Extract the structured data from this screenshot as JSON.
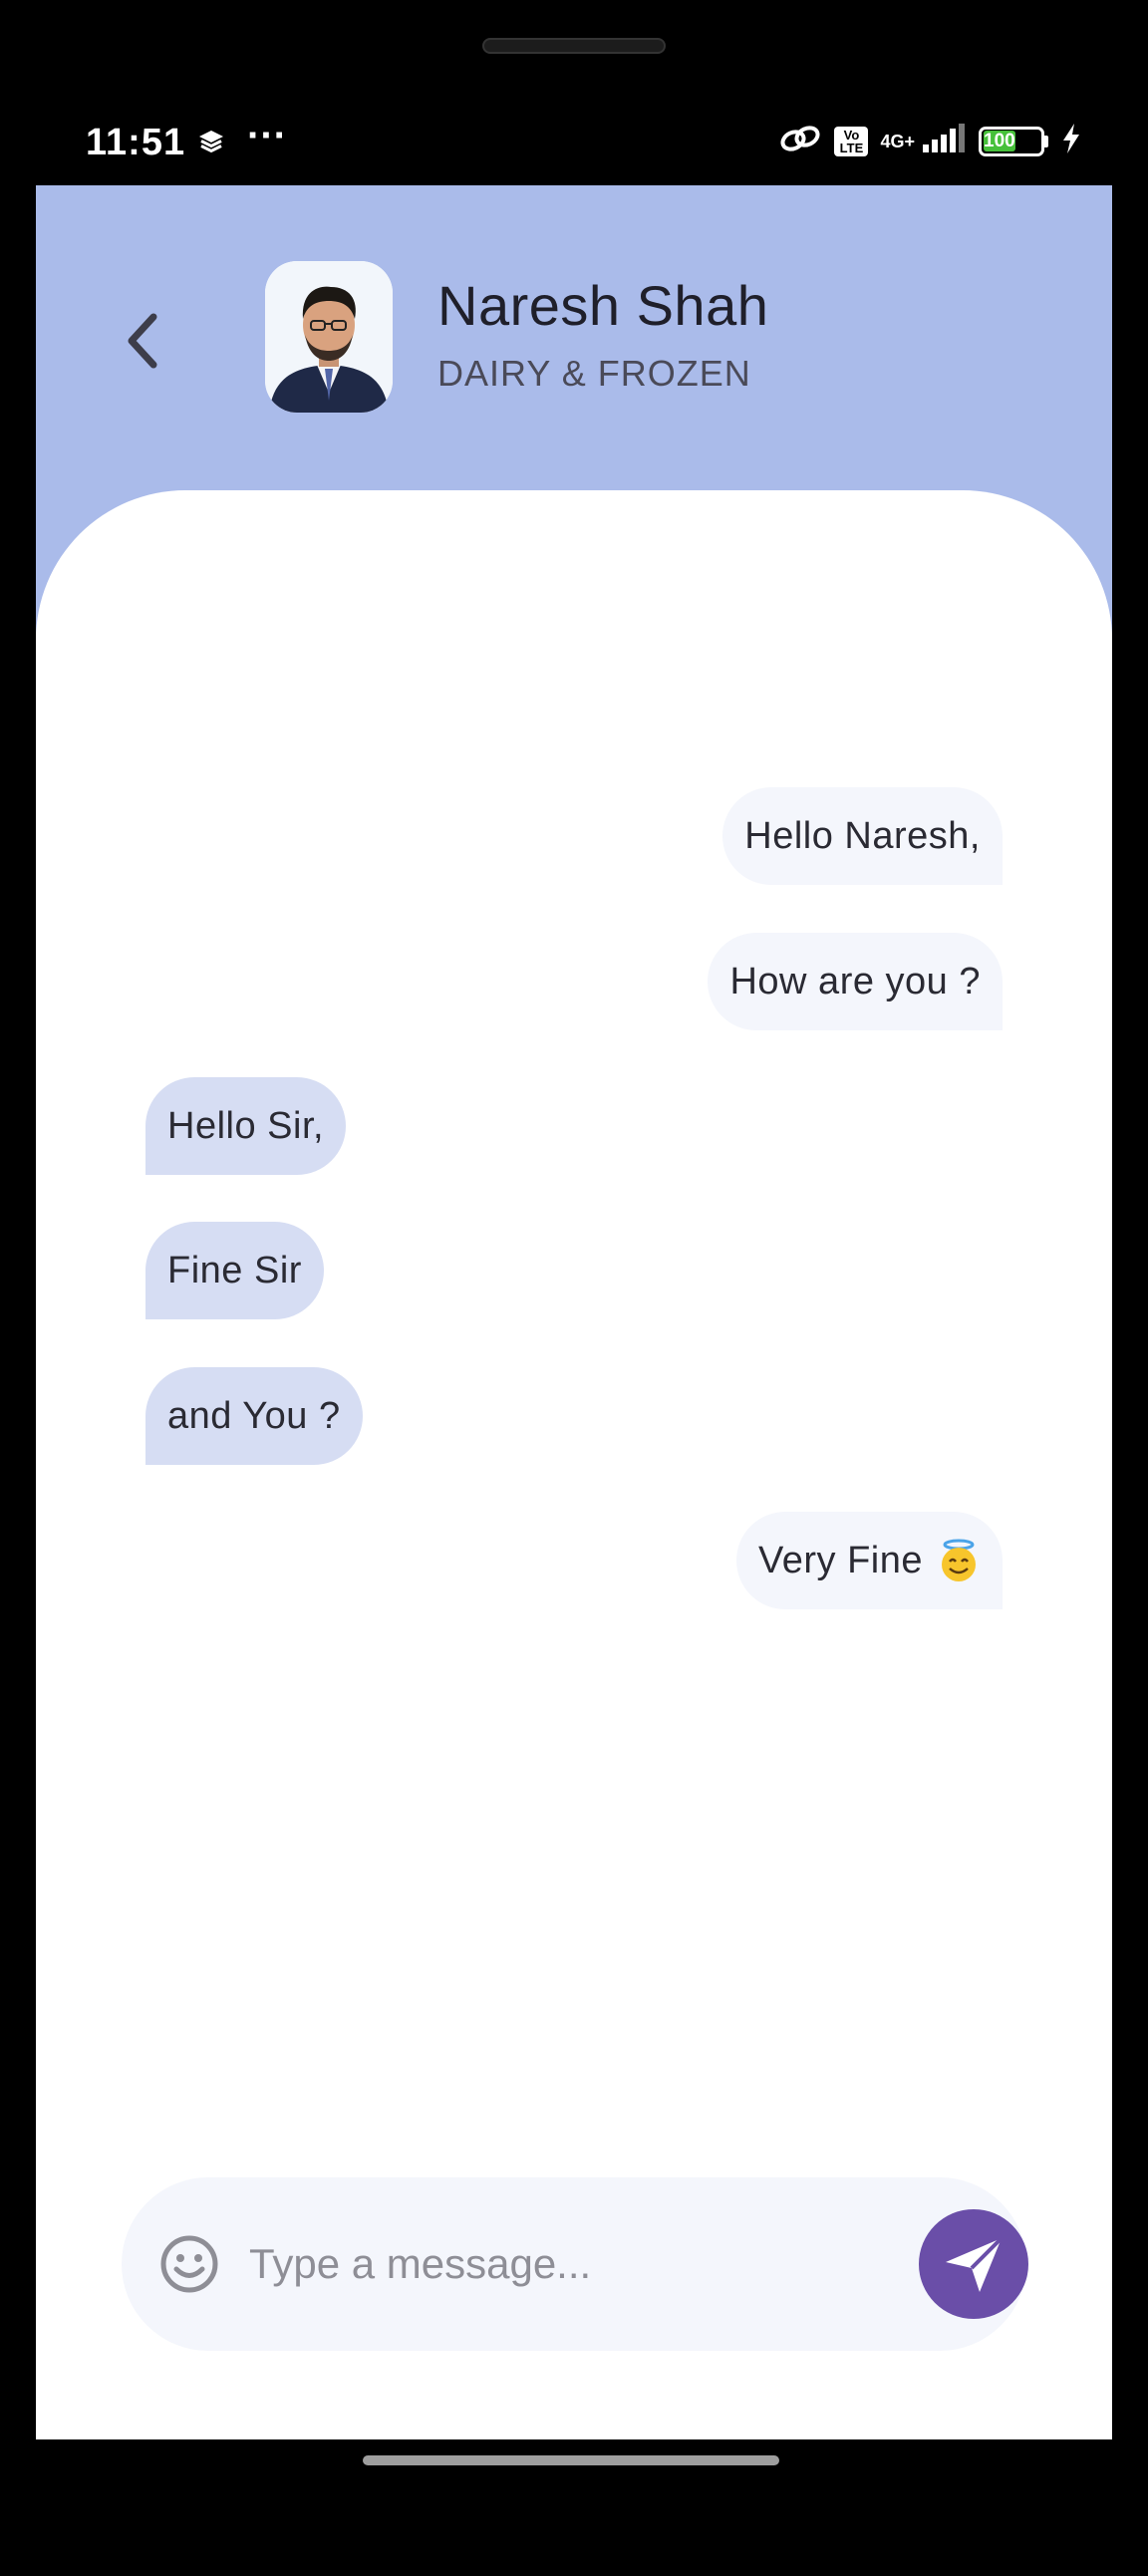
{
  "status_bar": {
    "time": "11:51",
    "dots": "···",
    "volte_label": "Vo LTE",
    "network": "4G+",
    "battery": "100"
  },
  "header": {
    "contact_name": "Naresh Shah",
    "contact_department": "DAIRY & FROZEN",
    "colors": {
      "header_bg": "#aabbea",
      "received_bubble": "#d6ddf3",
      "sent_bubble": "#f4f6fc",
      "send_button": "#6a4ea8"
    }
  },
  "messages": [
    {
      "text": "Hello Naresh,",
      "direction": "sent"
    },
    {
      "text": "How are you ?",
      "direction": "sent"
    },
    {
      "text": "Hello Sir,",
      "direction": "received"
    },
    {
      "text": "Fine Sir",
      "direction": "received"
    },
    {
      "text": "and You ?",
      "direction": "received"
    },
    {
      "text": "Very Fine",
      "direction": "sent",
      "emoji": "smiling-face-with-halo"
    }
  ],
  "composer": {
    "placeholder": "Type a message...",
    "value": ""
  },
  "icons": {
    "back": "chevron-left-icon",
    "emoji": "smile-icon",
    "send": "send-plane-icon"
  }
}
